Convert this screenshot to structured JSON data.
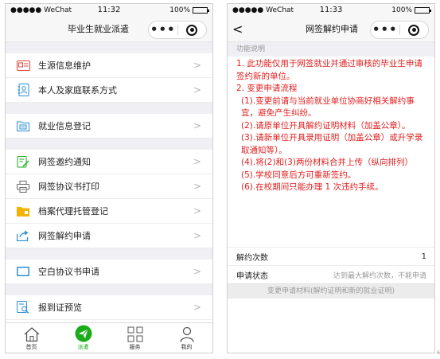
{
  "left": {
    "status": {
      "carrier": "●●●●● WeChat",
      "time": "11:32",
      "battery": "100%"
    },
    "title": "毕业生就业派遣",
    "capsule": {
      "more": "•••"
    },
    "menu": [
      {
        "label": "生源信息维护",
        "icon": "id-card-icon"
      },
      {
        "label": "本人及家庭联系方式",
        "icon": "contact-book-icon"
      },
      {
        "label": "就业信息登记",
        "icon": "folder-card-icon"
      },
      {
        "label": "网签邀约通知",
        "icon": "edit-note-icon"
      },
      {
        "label": "网签协议书打印",
        "icon": "printer-icon"
      },
      {
        "label": "档案代理托管登记",
        "icon": "folder-icon"
      },
      {
        "label": "网签解约申请",
        "icon": "share-out-icon"
      },
      {
        "label": "空白协议书申请",
        "icon": "blank-sheet-icon"
      },
      {
        "label": "报到证预览",
        "icon": "search-doc-icon"
      }
    ],
    "chevron": ">",
    "tabs": [
      {
        "label": "首页",
        "icon": "home-icon"
      },
      {
        "label": "派遣",
        "icon": "send-icon"
      },
      {
        "label": "服务",
        "icon": "grid-icon"
      },
      {
        "label": "我的",
        "icon": "user-icon"
      }
    ]
  },
  "right": {
    "status": {
      "carrier": "●●●●● WeChat",
      "time": "11:33",
      "battery": "100%"
    },
    "back": "<",
    "title": "网签解约申请",
    "capsule": {
      "more": "•••"
    },
    "section_label": "功能说明",
    "lines": [
      {
        "text": "1. 此功能仅用于网签就业并通过审核的毕业生申请签约新的单位。",
        "sub": false
      },
      {
        "text": "2. 变更申请流程",
        "sub": false
      },
      {
        "text": "(1).变更前请与当前就业单位协商好相关解约事宜，避免产生纠纷。",
        "sub": true
      },
      {
        "text": "(2).请原单位开具解约证明材料（加盖公章）。",
        "sub": true
      },
      {
        "text": "(3).请新单位开具录用证明（加盖公章）或升学录取通知等）。",
        "sub": true
      },
      {
        "text": "(4).将(2)和(3)两份材料合并上传（纵向排列）",
        "sub": true
      },
      {
        "text": "(5).学校同意后方可重新签约。",
        "sub": true
      },
      {
        "text": "(6).在校期间只能办理 1 次违约手续。",
        "sub": true
      }
    ],
    "rows": [
      {
        "key": "解约次数",
        "value": "1"
      },
      {
        "key": "申请状态",
        "value": "达到最大解约次数，不能申请"
      }
    ],
    "change_button": "变更申请材料(解约证明和新的就业证明)"
  },
  "corner_mark": "6"
}
